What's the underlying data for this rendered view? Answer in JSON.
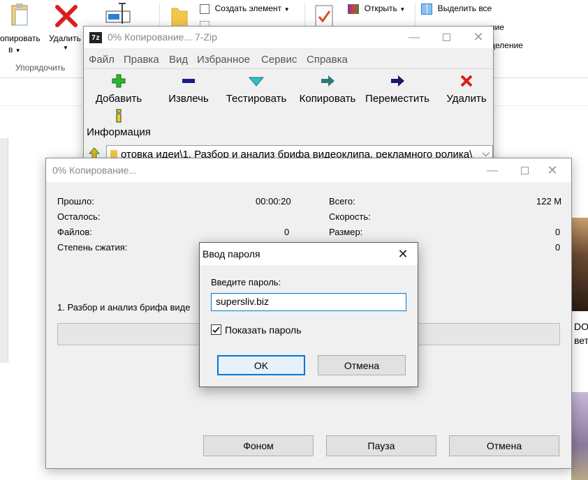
{
  "explorer": {
    "copy_to_label": "опировать",
    "copy_to_sub": "в",
    "delete_label": "Удалить",
    "group_label": "Упорядочить",
    "create_item_label": "Создать элемент",
    "open_label": "Открыть",
    "select_all_label": "Выделить все",
    "partial_1": "ние",
    "partial_2": "деление",
    "right_partial_1": "DO",
    "right_partial_2": "вето"
  },
  "zip_window": {
    "title": "0% Копирование... 7-Zip",
    "menu": [
      "Файл",
      "Правка",
      "Вид",
      "Избранное",
      "Сервис",
      "Справка"
    ],
    "toolbar": {
      "add": "Добавить",
      "extract": "Извлечь",
      "test": "Тестировать",
      "copy": "Копировать",
      "move": "Переместить",
      "delete": "Удалить",
      "info": "Информация"
    },
    "address": "отовка идеи\\1. Разбор и анализ брифа видеоклипа, рекламного ролика\\"
  },
  "progress_dialog": {
    "title": "0% Копирование...",
    "elapsed_label": "Прошло:",
    "elapsed_value": "00:00:20",
    "remaining_label": "Осталось:",
    "files_label": "Файлов:",
    "files_value": "0",
    "ratio_label": "Степень сжатия:",
    "total_label": "Всего:",
    "total_value": "122 M",
    "speed_label": "Скорость:",
    "size_label": "Размер:",
    "size_value": "0",
    "packed_value": "0",
    "current_file": "1. Разбор и анализ брифа виде",
    "progress_fraction": 0,
    "background_button": "Фоном",
    "pause_button": "Пауза",
    "cancel_button": "Отмена"
  },
  "password_dialog": {
    "title": "Ввод пароля",
    "prompt": "Введите пароль:",
    "password_value": "supersliv.biz",
    "show_password_label": "Показать пароль",
    "show_password_checked": true,
    "ok_button": "OK",
    "cancel_button": "Отмена"
  },
  "colors": {
    "add_icon": "#2db82d",
    "extract_icon": "#1a1a8c",
    "test_icon": "#30c0c0",
    "copy_icon": "#2a7a7a",
    "move_icon": "#1a1a6c",
    "delete_icon": "#d81e1e",
    "info_icon": "#e6d21a",
    "focus_border": "#0078d7"
  }
}
